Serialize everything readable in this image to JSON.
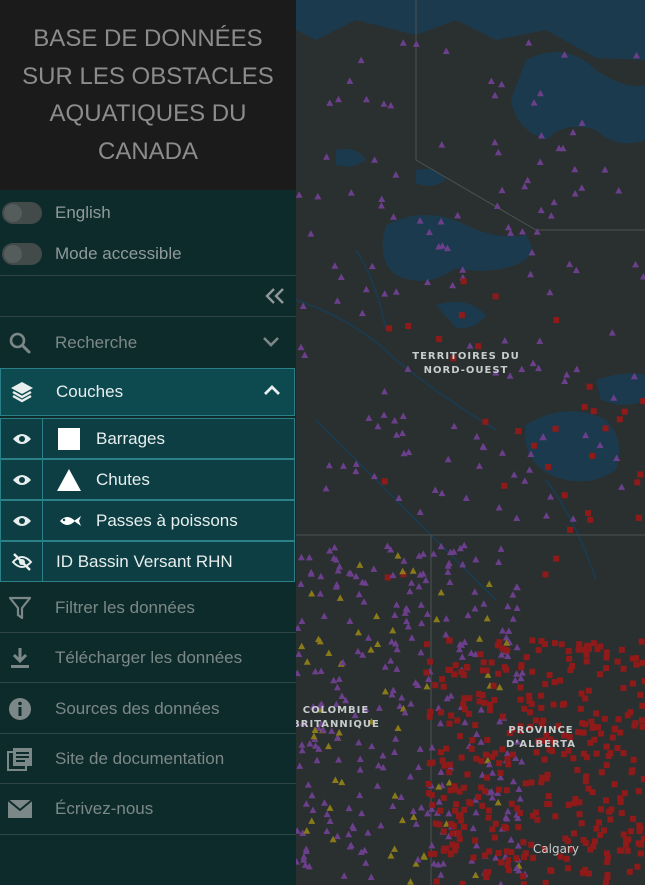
{
  "app": {
    "title": "BASE DE DONNÉES SUR LES OBSTACLES AQUATIQUES DU CANADA"
  },
  "toggles": [
    {
      "label": "English",
      "on": false
    },
    {
      "label": "Mode accessible",
      "on": false
    }
  ],
  "menu": {
    "recherche": "Recherche",
    "couches": "Couches",
    "filtrer": "Filtrer les données",
    "telecharger": "Télécharger les données",
    "sources": "Sources des données",
    "documentation": "Site de documentation",
    "ecrivez": "Écrivez-nous"
  },
  "layers": [
    {
      "label": "Barrages",
      "visible": true,
      "symbol": "square-icon"
    },
    {
      "label": "Chutes",
      "visible": true,
      "symbol": "triangle-icon"
    },
    {
      "label": "Passes à poissons",
      "visible": true,
      "symbol": "fish-icon"
    },
    {
      "label": "ID Bassin Versant RHN",
      "visible": false,
      "symbol": ""
    }
  ],
  "map": {
    "labels": {
      "tno": "TERRITOIRES DU NORD-OUEST",
      "cb": "COLOMBIE BRITANNIQUE",
      "ab": "PROVINCE D'ALBERTA",
      "calgary": "Calgary"
    },
    "colors": {
      "land": "#2a302f",
      "water": "#1c3a4d",
      "falls": "#6c3f8c",
      "dams": "#8f1a1a",
      "fishways": "#8a7a1a",
      "accent_teal": "#0d4a50"
    }
  }
}
